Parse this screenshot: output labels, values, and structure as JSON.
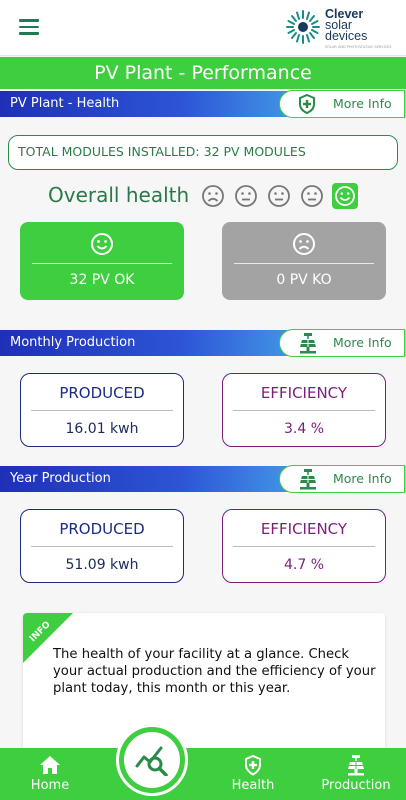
{
  "header": {
    "logo_line1": "Clever",
    "logo_line2": "solar",
    "logo_line3": "devices",
    "logo_tagline": "SOLAR AND PHOTOVOLTAIC SERVICES",
    "menu_icon": "hamburger-menu-icon"
  },
  "page": {
    "title": "PV Plant - Performance"
  },
  "health": {
    "section_label": "PV Plant - Health",
    "more_info": "More Info",
    "more_info_icon": "shield-plus-icon",
    "total_modules": "TOTAL MODULES INSTALLED: 32 PV MODULES",
    "overall_label": "Overall health",
    "faces": [
      "very-sad-face-icon",
      "neutral-face-icon",
      "neutral-face-icon",
      "neutral-face-icon",
      "happy-face-icon"
    ],
    "selected_face": "happy-face-icon",
    "ok_card": {
      "value": "32  PV OK",
      "icon": "happy-face-icon"
    },
    "ko_card": {
      "value": "0  PV KO",
      "icon": "sad-face-icon"
    }
  },
  "monthly": {
    "section_label": "Monthly Production",
    "more_info": "More Info",
    "more_info_icon": "solar-panel-icon",
    "produced_title": "PRODUCED",
    "produced_value": "16.01 kwh",
    "efficiency_title": "EFFICIENCY",
    "efficiency_value": "3.4 %"
  },
  "yearly": {
    "section_label": "Year Production",
    "more_info": "More Info",
    "more_info_icon": "solar-panel-icon",
    "produced_title": "PRODUCED",
    "produced_value": "51.09 kwh",
    "efficiency_title": "EFFICIENCY",
    "efficiency_value": "4.7 %"
  },
  "info": {
    "ribbon": "INFO",
    "text": "The health of your facility at a glance. Check your actual production and the efficiency of your plant today, this month or this year."
  },
  "nav": {
    "home": "Home",
    "health": "Health",
    "production": "Production",
    "fab_icon": "chart-search-icon"
  },
  "colors": {
    "accent_green": "#3fce3f",
    "dark_green": "#2a7a48",
    "ko_grey": "#a3a3a3",
    "produced_navy": "#1c2a86",
    "efficiency_purple": "#7a1e7a",
    "section_gradient_start": "#1f2fb8",
    "section_gradient_end": "#8fd9f3"
  }
}
